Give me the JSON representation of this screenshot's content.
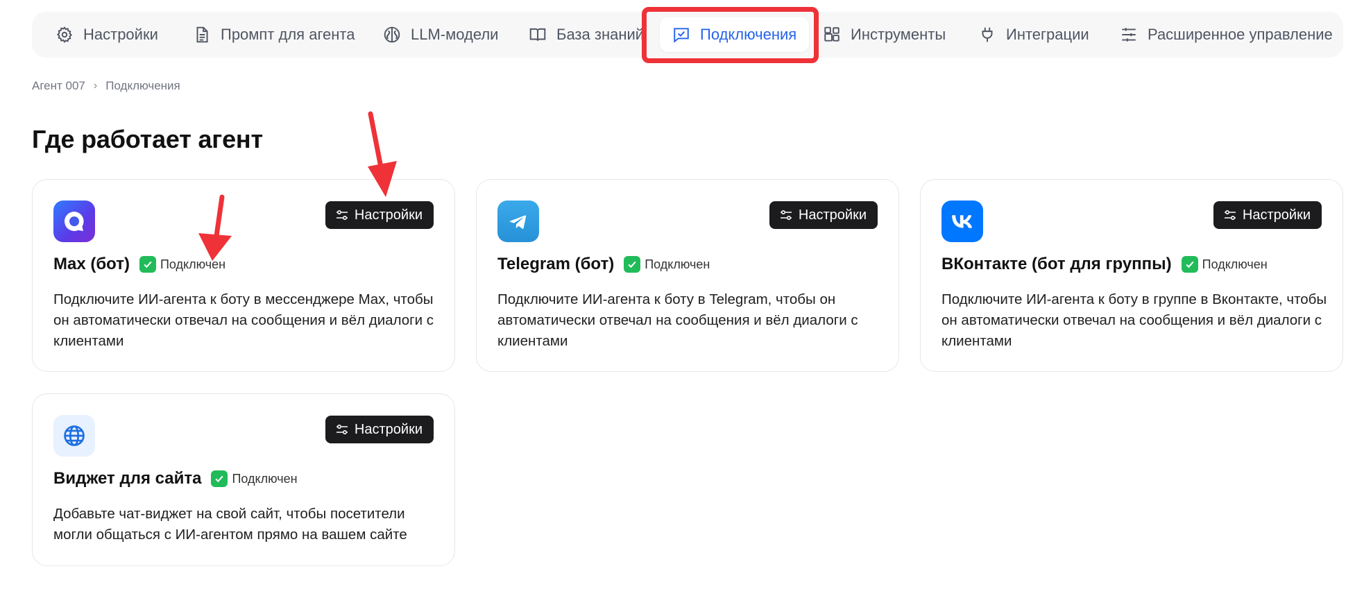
{
  "nav": {
    "items": [
      {
        "label": "Настройки",
        "icon": "gear-icon"
      },
      {
        "label": "Промпт для агента",
        "icon": "document-icon"
      },
      {
        "label": "LLM-модели",
        "icon": "brain-icon"
      },
      {
        "label": "База знаний",
        "icon": "book-icon"
      },
      {
        "label": "Подключения",
        "icon": "chat-check-icon",
        "active": true
      },
      {
        "label": "Инструменты",
        "icon": "blocks-icon"
      },
      {
        "label": "Интеграции",
        "icon": "plug-icon"
      },
      {
        "label": "Расширенное управление",
        "icon": "sliders-icon"
      }
    ],
    "active_color": "#2563eb"
  },
  "breadcrumb": {
    "items": [
      "Агент 007",
      "Подключения"
    ],
    "separator": "›"
  },
  "page_title": "Где работает агент",
  "cards": [
    {
      "title": "Max (бот)",
      "status": "Подключен",
      "settings_label": "Настройки",
      "description": "Подключите ИИ-агента к боту в мессенджере Max, чтобы он автоматически отвечал на сообщения и вёл диалоги с клиентами",
      "icon": "max-logo"
    },
    {
      "title": "Telegram (бот)",
      "status": "Подключен",
      "settings_label": "Настройки",
      "description": "Подключите ИИ-агента к боту в Telegram, чтобы он автоматически отвечал на сообщения и вёл диалоги с клиентами",
      "icon": "telegram-logo"
    },
    {
      "title": "ВКонтакте (бот для группы)",
      "status": "Подключен",
      "settings_label": "Настройки",
      "description": "Подключите ИИ-агента к боту в группе в Вконтакте, чтобы он автоматически отвечал на сообщения и вёл диалоги с клиентами",
      "icon": "vk-logo"
    },
    {
      "title": "Виджет для сайта",
      "status": "Подключен",
      "settings_label": "Настройки",
      "description": "Добавьте чат-виджет на свой сайт, чтобы посетители могли общаться с ИИ-агентом прямо на вашем сайте",
      "icon": "globe-icon"
    }
  ],
  "colors": {
    "status_green": "#21bb5a",
    "annotation_red": "#ee3238",
    "button_dark": "#1c1c1e"
  }
}
